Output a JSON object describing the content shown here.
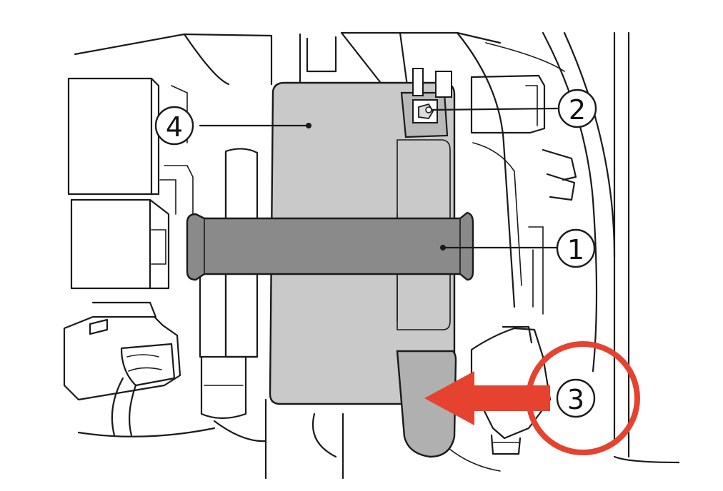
{
  "figure": {
    "background": "#ffffff",
    "line_color": "#1a1a1a",
    "module_fill": "#c9c9c9",
    "strap_fill": "#8a8a8a",
    "clip_fill": "#b0b0b0",
    "highlight_color": "#e5432f"
  },
  "callouts": [
    {
      "label": "1",
      "name": "strap-callout"
    },
    {
      "label": "2",
      "name": "nut-callout"
    },
    {
      "label": "3",
      "name": "clip-callout"
    },
    {
      "label": "4",
      "name": "module-callout"
    }
  ]
}
